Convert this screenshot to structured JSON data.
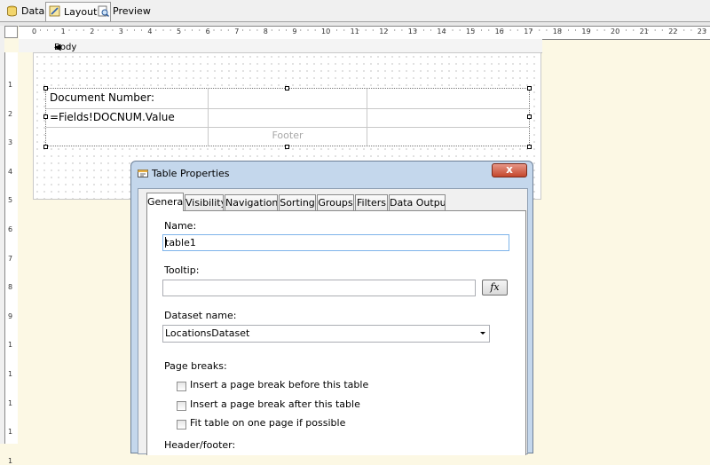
{
  "tabs": [
    {
      "label": "Data",
      "icon": "data-icon"
    },
    {
      "label": "Layout",
      "icon": "layout-icon",
      "active": true
    },
    {
      "label": "Preview",
      "icon": "preview-icon"
    }
  ],
  "ruler": {
    "h_numbers": [
      "0",
      "1",
      "2",
      "3",
      "4",
      "5",
      "6",
      "7",
      "8",
      "9",
      "10",
      "11",
      "12",
      "13",
      "14",
      "15",
      "16",
      "17",
      "18",
      "19",
      "20",
      "21",
      "22",
      "23"
    ],
    "v_numbers": [
      "1",
      "2",
      "3",
      "4",
      "5",
      "6",
      "7",
      "8",
      "9",
      "1",
      "1",
      "1",
      "1",
      "1"
    ]
  },
  "report": {
    "section_label": "Body",
    "table": {
      "header_text": "Document Number:",
      "detail_text": "=Fields!DOCNUM.Value",
      "footer_label": "Footer"
    }
  },
  "dialog": {
    "title": "Table Properties",
    "close_label": "x",
    "tabs": [
      "General",
      "Visibility",
      "Navigation",
      "Sorting",
      "Groups",
      "Filters",
      "Data Output"
    ],
    "name_label": "Name:",
    "name_value": "table1",
    "tooltip_label": "Tooltip:",
    "tooltip_value": "",
    "fx_label": "fx",
    "dataset_label": "Dataset name:",
    "dataset_value": "LocationsDataset",
    "page_breaks_label": "Page breaks:",
    "page_breaks": [
      {
        "label": "Insert a page break before this table",
        "checked": false
      },
      {
        "label": "Insert a page break after this table",
        "checked": false
      },
      {
        "label": "Fit table on one page if possible",
        "checked": false
      }
    ],
    "header_footer_label": "Header/footer:"
  },
  "colors": {
    "workspace": "#fcf8e4",
    "dialog_frame": "#c4d7ec",
    "close_button": "#c4472c",
    "focus_border": "#7eb4ea"
  }
}
